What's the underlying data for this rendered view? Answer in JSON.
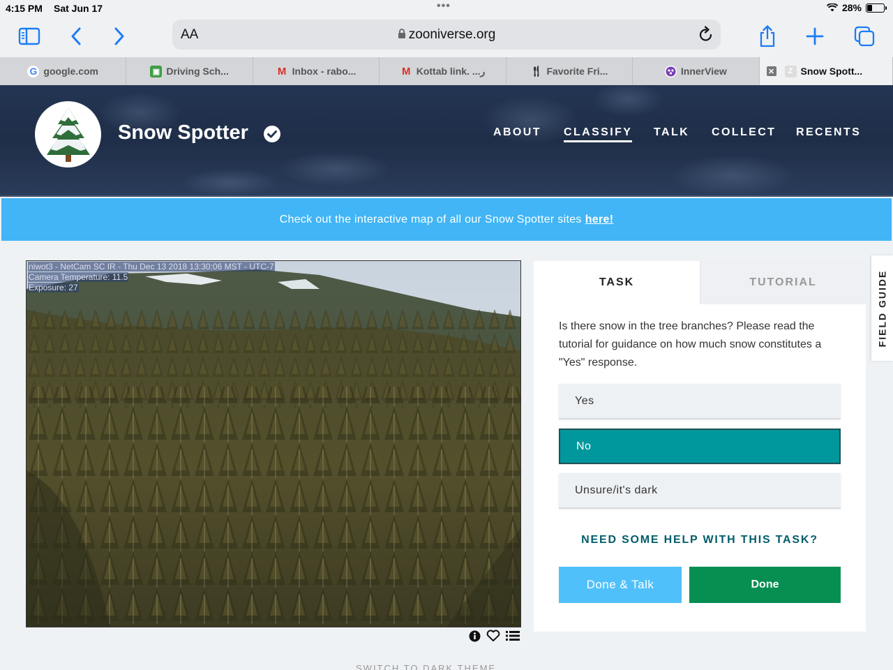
{
  "status_bar": {
    "time": "4:15 PM",
    "date": "Sat Jun 17",
    "battery": "28%",
    "battery_level": 0.28
  },
  "browser": {
    "aa_label": "AA",
    "url": "zooniverse.org",
    "tabs": [
      {
        "label": "google.com",
        "icon": "google-icon",
        "active": false
      },
      {
        "label": "Driving Sch...",
        "icon": "car-icon",
        "active": false
      },
      {
        "label": "Inbox - rabo...",
        "icon": "gmail-icon",
        "active": false
      },
      {
        "label": "Kottab link. ...ر",
        "icon": "gmail-icon",
        "active": false
      },
      {
        "label": "Favorite Fri...",
        "icon": "fork-knife-icon",
        "active": false
      },
      {
        "label": "InnerView",
        "icon": "innerview-icon",
        "active": false
      },
      {
        "label": "Snow Spott...",
        "icon": "zooniverse-icon",
        "active": true
      }
    ]
  },
  "site": {
    "title": "Snow Spotter",
    "nav": [
      "ABOUT",
      "CLASSIFY",
      "TALK",
      "COLLECT",
      "RECENTS"
    ],
    "active_nav": "CLASSIFY"
  },
  "banner": {
    "text": "Check out the interactive map of all our Snow Spotter sites",
    "link": "here!"
  },
  "subject": {
    "line1": "niwot3  -  NetCam SC IR  -  Thu Dec 13 2018 13:30:06 MST - UTC-7",
    "line2": "Camera Temperature:  11.5",
    "line3": "Exposure: 27"
  },
  "task_panel": {
    "tab_task": "TASK",
    "tab_tutorial": "TUTORIAL",
    "question": "Is there snow in the tree branches? Please read the tutorial for guidance on how much snow constitutes a \"Yes\" response.",
    "answers": [
      "Yes",
      "No",
      "Unsure/it's dark"
    ],
    "selected_answer": "No",
    "help": "NEED SOME HELP WITH THIS TASK?",
    "done_talk": "Done & Talk",
    "done": "Done"
  },
  "field_guide": "FIELD GUIDE",
  "footer_hint": "SWITCH TO DARK THEME",
  "colors": {
    "banner": "#41b5f5",
    "selected_answer": "#00979d",
    "done": "#078f52",
    "done_talk": "#50c0fb"
  }
}
